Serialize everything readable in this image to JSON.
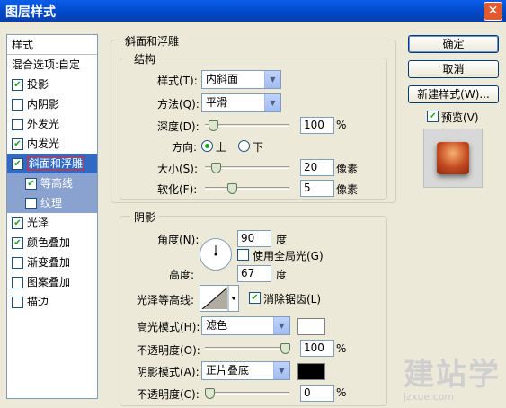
{
  "window": {
    "title": "图层样式",
    "close_glyph": "✕"
  },
  "style_list": {
    "header": "样式",
    "items": [
      {
        "label": "混合选项:自定",
        "checkbox": false,
        "checked": false
      },
      {
        "label": "投影",
        "checkbox": true,
        "checked": true
      },
      {
        "label": "内阴影",
        "checkbox": true,
        "checked": false
      },
      {
        "label": "外发光",
        "checkbox": true,
        "checked": false
      },
      {
        "label": "内发光",
        "checkbox": true,
        "checked": true
      },
      {
        "label": "斜面和浮雕",
        "checkbox": true,
        "checked": true,
        "selected": true
      },
      {
        "label": "等高线",
        "checkbox": true,
        "checked": true,
        "sub": true
      },
      {
        "label": "纹理",
        "checkbox": true,
        "checked": false,
        "sub": true
      },
      {
        "label": "光泽",
        "checkbox": true,
        "checked": true
      },
      {
        "label": "颜色叠加",
        "checkbox": true,
        "checked": true
      },
      {
        "label": "渐变叠加",
        "checkbox": true,
        "checked": false
      },
      {
        "label": "图案叠加",
        "checkbox": true,
        "checked": false
      },
      {
        "label": "描边",
        "checkbox": true,
        "checked": false
      }
    ]
  },
  "bevel": {
    "group_title": "斜面和浮雕",
    "structure": {
      "title": "结构",
      "style_label": "样式(T):",
      "style_value": "内斜面",
      "method_label": "方法(Q):",
      "method_value": "平滑",
      "depth_label": "深度(D):",
      "depth_value": "100",
      "depth_unit": "%",
      "depth_level": 0.05,
      "direction_label": "方向:",
      "dir_up": "上",
      "dir_down": "下",
      "size_label": "大小(S):",
      "size_value": "20",
      "size_unit": "像素",
      "size_level": 0.08,
      "soften_label": "软化(F):",
      "soften_value": "5",
      "soften_unit": "像素",
      "soften_level": 0.3
    },
    "shading": {
      "title": "阴影",
      "angle_label": "角度(N):",
      "angle_value": "90",
      "angle_unit": "度",
      "global_light_label": "使用全局光(G)",
      "altitude_label": "高度:",
      "altitude_value": "67",
      "altitude_unit": "度",
      "gloss_label": "光泽等高线:",
      "antialias_label": "消除锯齿(L)",
      "highlight_mode_label": "高光模式(H):",
      "highlight_mode_value": "滤色",
      "highlight_color": "#ffffff",
      "highlight_opacity_label": "不透明度(O):",
      "highlight_opacity_value": "100",
      "highlight_opacity_unit": "%",
      "highlight_opacity_level": 1.0,
      "shadow_mode_label": "阴影模式(A):",
      "shadow_mode_value": "正片叠底",
      "shadow_color": "#000000",
      "shadow_opacity_label": "不透明度(C):",
      "shadow_opacity_value": "0",
      "shadow_opacity_unit": "%",
      "shadow_opacity_level": 0.0
    }
  },
  "buttons": {
    "ok": "确定",
    "cancel": "取消",
    "new_style": "新建样式(W)...",
    "preview_label": "预览(V)"
  },
  "watermark": {
    "big": "建站学",
    "small": "jzxue.com"
  }
}
